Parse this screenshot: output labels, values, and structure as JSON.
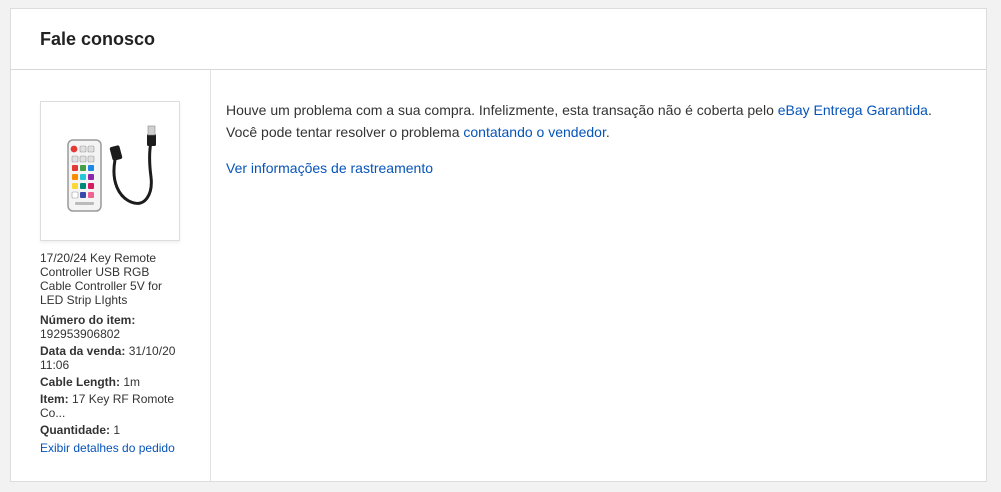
{
  "header": {
    "title": "Fale conosco"
  },
  "item": {
    "title": "17/20/24 Key Remote Controller USB RGB Cable Controller 5V for LED Strip LIghts",
    "details": [
      {
        "label": "Número do item:",
        "value": "192953906802"
      },
      {
        "label": "Data da venda:",
        "value": "31/10/20 11:06"
      },
      {
        "label": "Cable Length:",
        "value": "1m"
      },
      {
        "label": "Item:",
        "value": "17 Key RF Romote Co..."
      },
      {
        "label": "Quantidade:",
        "value": "1"
      }
    ],
    "details_link": "Exibir detalhes do pedido",
    "image_icon": "rgb-remote-controller-product-image"
  },
  "message": {
    "line1_text": "Houve um problema com a sua compra. Infelizmente, esta transação não é coberta pelo ",
    "line1_link": "eBay Entrega Garantida",
    "line1_end": ".",
    "line2_text": "Você pode tentar resolver o problema ",
    "line2_link": "contatando o vendedor",
    "line2_end": ".",
    "tracking_link": "Ver informações de rastreamento"
  },
  "colors": {
    "link": "#0654ba",
    "text": "#333333",
    "background": "#f2f2f2"
  }
}
